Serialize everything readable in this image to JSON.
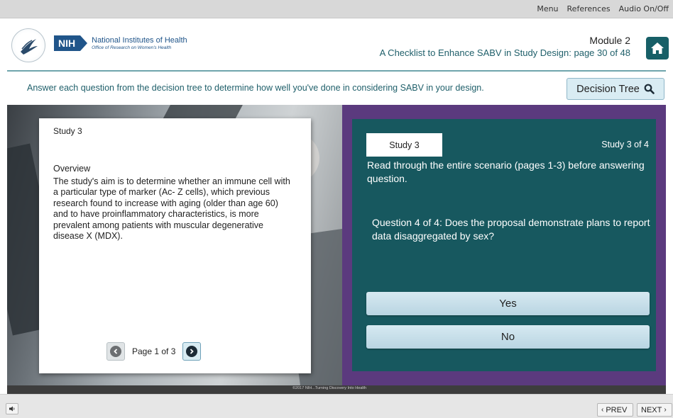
{
  "topbar": {
    "menu": "Menu",
    "references": "References",
    "audio": "Audio On/Off"
  },
  "header": {
    "org_line1": "National Institutes of Health",
    "org_line2": "Office of Research on Women's Health",
    "nih_abbrev": "NIH",
    "module": "Module 2",
    "title": "A Checklist to Enhance SABV in Study Design: page 30 of 48",
    "home_icon": "home-icon"
  },
  "instruction": {
    "text": "Answer each question from the decision tree to determine how well you've done in considering SABV in your design.",
    "decision_tree_label": "Decision Tree"
  },
  "left_card": {
    "title": "Study 3",
    "overview_heading": "Overview",
    "overview_body": "The study's aim is to determine whether an immune cell with a particular type of marker (Ac- Z cells), which previous research found to increase with aging (older than age 60) and to have proinflammatory characteristics, is more prevalent among patients with muscular degenerative disease X (MDX).",
    "pager": "Page 1 of 3"
  },
  "right_panel": {
    "tab": "Study 3",
    "counter": "Study 3  of  4",
    "instruction": "Read through the entire scenario (pages 1-3) before answering question.",
    "question": "Question 4 of 4: Does the proposal demonstrate plans to report data disaggregated by sex?",
    "answers": {
      "yes": "Yes",
      "no": "No"
    }
  },
  "copyright": "©2017 NIH...Turning Discovery Into Health",
  "footer": {
    "prev": "PREV",
    "next": "NEXT"
  },
  "colors": {
    "teal": "#17585f",
    "purple": "#5b3a7e",
    "accent_text": "#1f5f6a",
    "button_light": "#d9ecf3"
  }
}
